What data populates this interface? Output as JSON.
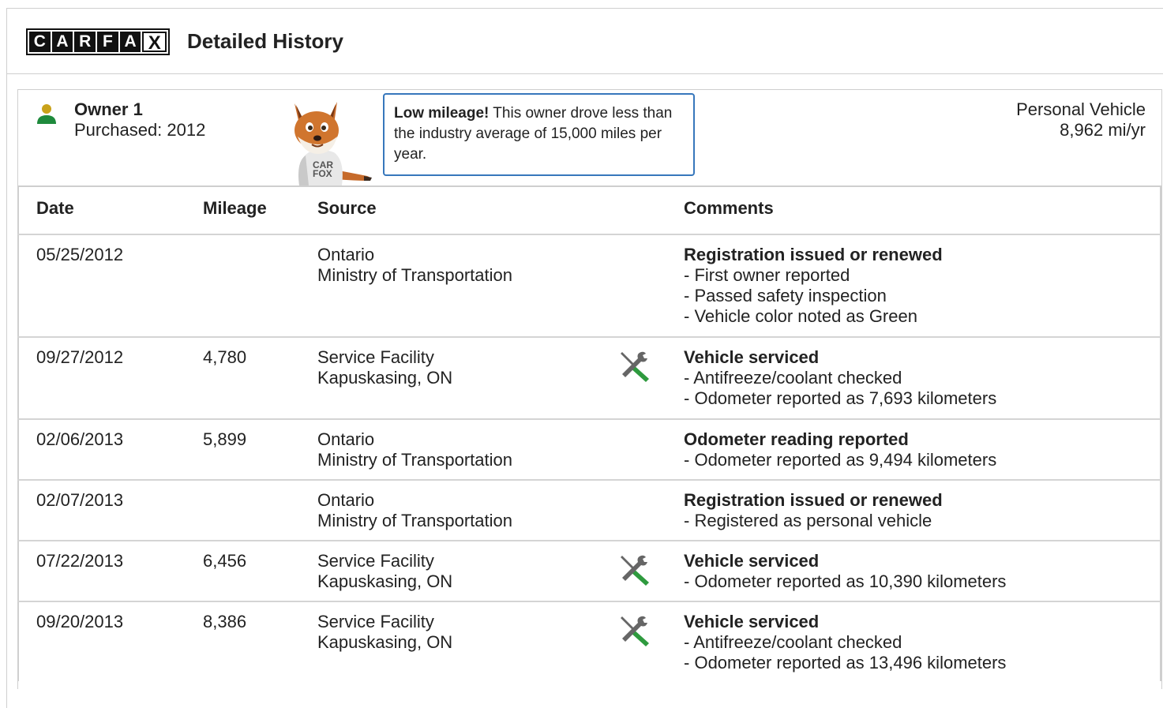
{
  "header": {
    "logo_letters": [
      "C",
      "A",
      "R",
      "F",
      "A",
      "X"
    ],
    "title": "Detailed History"
  },
  "owner": {
    "name": "Owner 1",
    "purchased": "Purchased: 2012",
    "callout_bold": "Low mileage!",
    "callout_text": " This owner drove less than the industry average of 15,000 miles per year.",
    "fox_shirt": "CAR FOX",
    "vehicle_type": "Personal Vehicle",
    "miles_per_year": "8,962 mi/yr"
  },
  "table": {
    "columns": [
      "Date",
      "Mileage",
      "Source",
      "Comments"
    ],
    "rows": [
      {
        "date": "05/25/2012",
        "mileage": "",
        "source": [
          "Ontario",
          "Ministry of Transportation"
        ],
        "service_icon": false,
        "comment_title": "Registration issued or renewed",
        "comment_lines": [
          "First owner reported",
          "Passed safety inspection",
          "Vehicle color noted as Green"
        ]
      },
      {
        "date": "09/27/2012",
        "mileage": "4,780",
        "source": [
          "Service Facility",
          "Kapuskasing, ON"
        ],
        "service_icon": true,
        "comment_title": "Vehicle serviced",
        "comment_lines": [
          "Antifreeze/coolant checked",
          "Odometer reported as 7,693 kilometers"
        ]
      },
      {
        "date": "02/06/2013",
        "mileage": "5,899",
        "source": [
          "Ontario",
          "Ministry of Transportation"
        ],
        "service_icon": false,
        "comment_title": "Odometer reading reported",
        "comment_lines": [
          "Odometer reported as 9,494 kilometers"
        ]
      },
      {
        "date": "02/07/2013",
        "mileage": "",
        "source": [
          "Ontario",
          "Ministry of Transportation"
        ],
        "service_icon": false,
        "comment_title": "Registration issued or renewed",
        "comment_lines": [
          "Registered as personal vehicle"
        ]
      },
      {
        "date": "07/22/2013",
        "mileage": "6,456",
        "source": [
          "Service Facility",
          "Kapuskasing, ON"
        ],
        "service_icon": true,
        "comment_title": "Vehicle serviced",
        "comment_lines": [
          "Odometer reported as 10,390 kilometers"
        ]
      },
      {
        "date": "09/20/2013",
        "mileage": "8,386",
        "source": [
          "Service Facility",
          "Kapuskasing, ON"
        ],
        "service_icon": true,
        "comment_title": "Vehicle serviced",
        "comment_lines": [
          "Antifreeze/coolant checked",
          "Odometer reported as 13,496 kilometers"
        ]
      }
    ]
  },
  "colors": {
    "callout_border": "#3777bc",
    "owner_icon_head": "#c9a21a",
    "owner_icon_body": "#1e8a3c",
    "wrench_gray": "#666666",
    "wrench_green": "#2e9a3e"
  }
}
